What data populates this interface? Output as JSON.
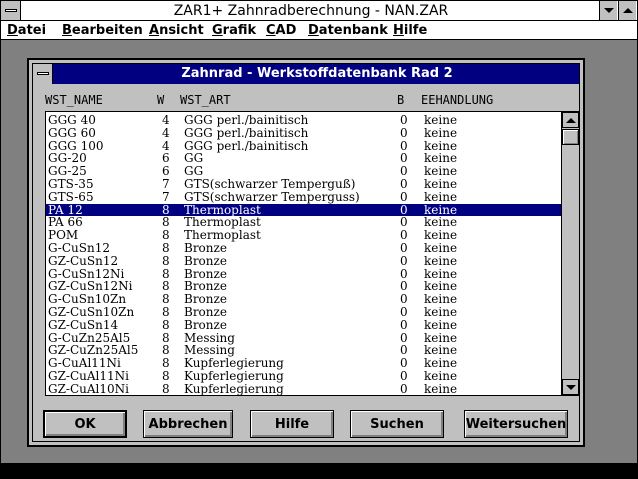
{
  "window": {
    "title": "ZAR1+ Zahnradberechnung  -  NAN.ZAR"
  },
  "menu": [
    "Datei",
    "Bearbeiten",
    "Ansicht",
    "Grafik",
    "CAD",
    "Datenbank",
    "Hilfe"
  ],
  "dialog": {
    "title": "Zahnrad - Werkstoffdatenbank Rad 2",
    "columns": {
      "name": "WST_NAME",
      "w": "W",
      "art": "WST_ART",
      "b": "B",
      "beh": "EEHANDLUNG"
    },
    "selected_index": 7,
    "rows": [
      {
        "name": "GGG 40",
        "w": "4",
        "art": "GGG perl./bainitisch",
        "b": "0",
        "beh": "keine"
      },
      {
        "name": "GGG 60",
        "w": "4",
        "art": "GGG perl./bainitisch",
        "b": "0",
        "beh": "keine"
      },
      {
        "name": "GGG 100",
        "w": "4",
        "art": "GGG perl./bainitisch",
        "b": "0",
        "beh": "keine"
      },
      {
        "name": "GG-20",
        "w": "6",
        "art": "GG",
        "b": "0",
        "beh": "keine"
      },
      {
        "name": "GG-25",
        "w": "6",
        "art": "GG",
        "b": "0",
        "beh": "keine"
      },
      {
        "name": "GTS-35",
        "w": "7",
        "art": "GTS(schwarzer Temperguß)",
        "b": "0",
        "beh": "keine"
      },
      {
        "name": "GTS-65",
        "w": "7",
        "art": "GTS(schwarzer Temperguss)",
        "b": "0",
        "beh": "keine"
      },
      {
        "name": "PA 12",
        "w": "8",
        "art": "Thermoplast",
        "b": "0",
        "beh": "keine"
      },
      {
        "name": "PA 66",
        "w": "8",
        "art": "Thermoplast",
        "b": "0",
        "beh": "keine"
      },
      {
        "name": "POM",
        "w": "8",
        "art": "Thermoplast",
        "b": "0",
        "beh": "keine"
      },
      {
        "name": "G-CuSn12",
        "w": "8",
        "art": "Bronze",
        "b": "0",
        "beh": "keine"
      },
      {
        "name": "GZ-CuSn12",
        "w": "8",
        "art": "Bronze",
        "b": "0",
        "beh": "keine"
      },
      {
        "name": "G-CuSn12Ni",
        "w": "8",
        "art": "Bronze",
        "b": "0",
        "beh": "keine"
      },
      {
        "name": "GZ-CuSn12Ni",
        "w": "8",
        "art": "Bronze",
        "b": "0",
        "beh": "keine"
      },
      {
        "name": "G-CuSn10Zn",
        "w": "8",
        "art": "Bronze",
        "b": "0",
        "beh": "keine"
      },
      {
        "name": "GZ-CuSn10Zn",
        "w": "8",
        "art": "Bronze",
        "b": "0",
        "beh": "keine"
      },
      {
        "name": "GZ-CuSn14",
        "w": "8",
        "art": "Bronze",
        "b": "0",
        "beh": "keine"
      },
      {
        "name": "G-CuZn25Al5",
        "w": "8",
        "art": "Messing",
        "b": "0",
        "beh": "keine"
      },
      {
        "name": "GZ-CuZn25Al5",
        "w": "8",
        "art": "Messing",
        "b": "0",
        "beh": "keine"
      },
      {
        "name": "G-CuAl11Ni",
        "w": "8",
        "art": "Kupferlegierung",
        "b": "0",
        "beh": "keine"
      },
      {
        "name": "GZ-CuAl11Ni",
        "w": "8",
        "art": "Kupferlegierung",
        "b": "0",
        "beh": "keine"
      },
      {
        "name": "GZ-CuAl10Ni",
        "w": "8",
        "art": "Kupferlegierung",
        "b": "0",
        "beh": "keine"
      }
    ],
    "buttons": {
      "ok": "OK",
      "cancel": "Abbrechen",
      "help": "Hilfe",
      "search": "Suchen",
      "search_next": "Weitersuchen"
    }
  },
  "colors": {
    "titlebar_active": "#000080",
    "face": "#c0c0c0",
    "desktop": "#808080",
    "selection": "#000080"
  },
  "icons": {
    "system_menu": "system-menu-icon",
    "minimize": "minimize-icon",
    "maximize": "maximize-icon",
    "scroll_up": "scroll-up-icon",
    "scroll_down": "scroll-down-icon"
  }
}
